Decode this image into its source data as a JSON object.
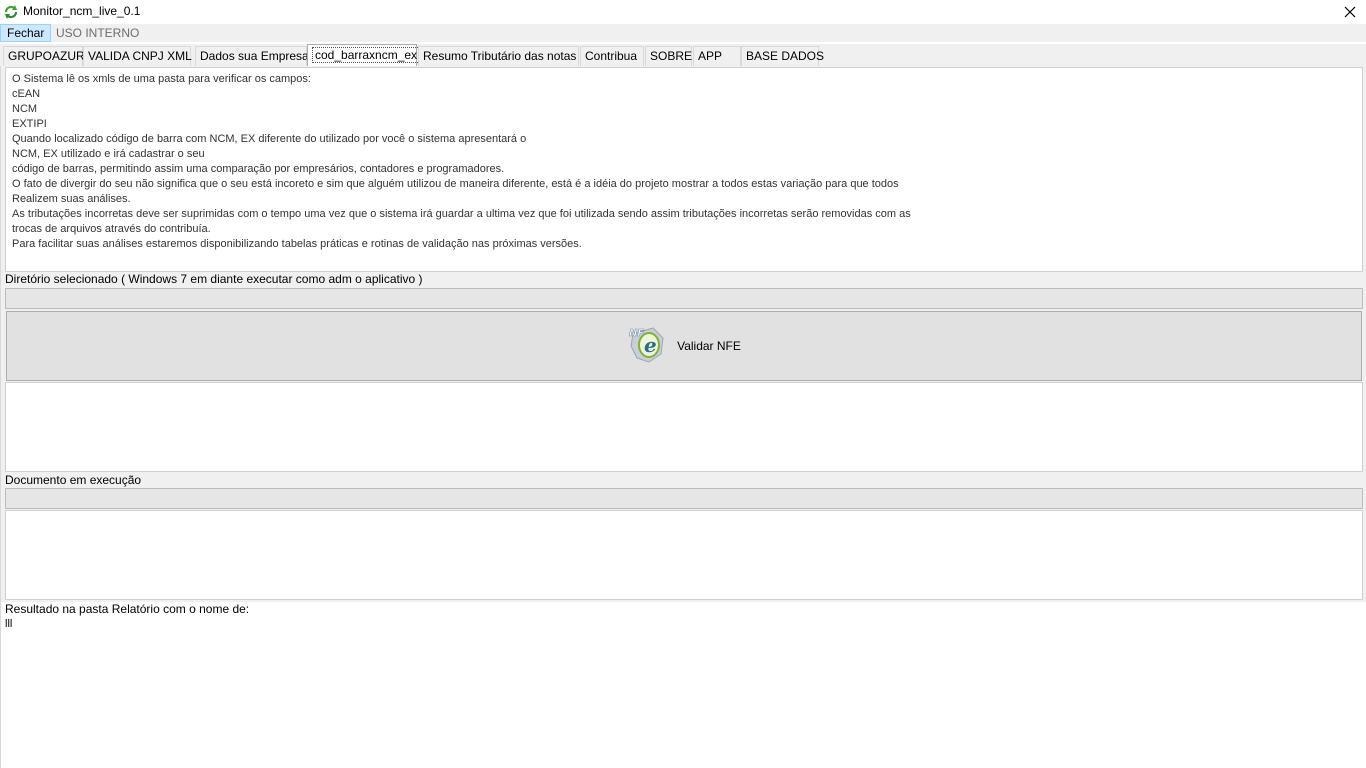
{
  "window": {
    "title": "Monitor_ncm_live_0.1",
    "app_icon": "refresh-arrows-icon",
    "close_icon": "close-icon"
  },
  "menu": {
    "items": [
      {
        "label": "Fechar"
      },
      {
        "label": "USO INTERNO"
      }
    ]
  },
  "tabs": [
    {
      "label": "GRUPOAZUR"
    },
    {
      "label": "VALIDA CNPJ XML"
    },
    {
      "label": "Dados sua Empresa"
    },
    {
      "label": "cod_barraxncm_ex"
    },
    {
      "label": "Resumo Tributário das notas"
    },
    {
      "label": "Contribua"
    },
    {
      "label": "SOBRE"
    },
    {
      "label": "APP"
    },
    {
      "label": "BASE DADOS"
    }
  ],
  "selected_tab": "cod_barraxncm_ex",
  "description": {
    "lines": [
      "O Sistema lê os xmls de uma pasta para verificar os campos:",
      "cEAN",
      "NCM",
      "EXTIPI",
      "Quando localizado código de barra com NCM, EX diferente do utilizado por você o sistema apresentará o",
      "NCM, EX utilizado e irá cadastrar o seu",
      "código de barras, permitindo assim uma comparação por empresários, contadores e programadores.",
      "O fato de divergir do seu não significa que o seu está incoreto e sim que alguém utilizou de maneira diferente, está é a idéia do projeto mostrar a todos estas variação para que todos",
      "Realizem suas análises.",
      "As tributações incorretas deve ser suprimidas com o tempo uma vez que o sistema irá guardar a ultima vez que foi utilizada sendo assim tributações incorretas serão removidas com as",
      "trocas de arquivos através do contribuía.",
      "Para facilitar suas análises estaremos disponibilizando tabelas práticas e rotinas de validação nas próximas versões."
    ]
  },
  "directory": {
    "label": "Diretório selecionado ( Windows 7 em diante executar como adm o aplicativo )"
  },
  "validate_button": {
    "label": "Validar NFE",
    "icon": "nfe-logo-icon"
  },
  "document": {
    "label": "Documento em execução"
  },
  "result": {
    "label": "Resultado na pasta Relatório com o nome de:",
    "value": "lll"
  }
}
